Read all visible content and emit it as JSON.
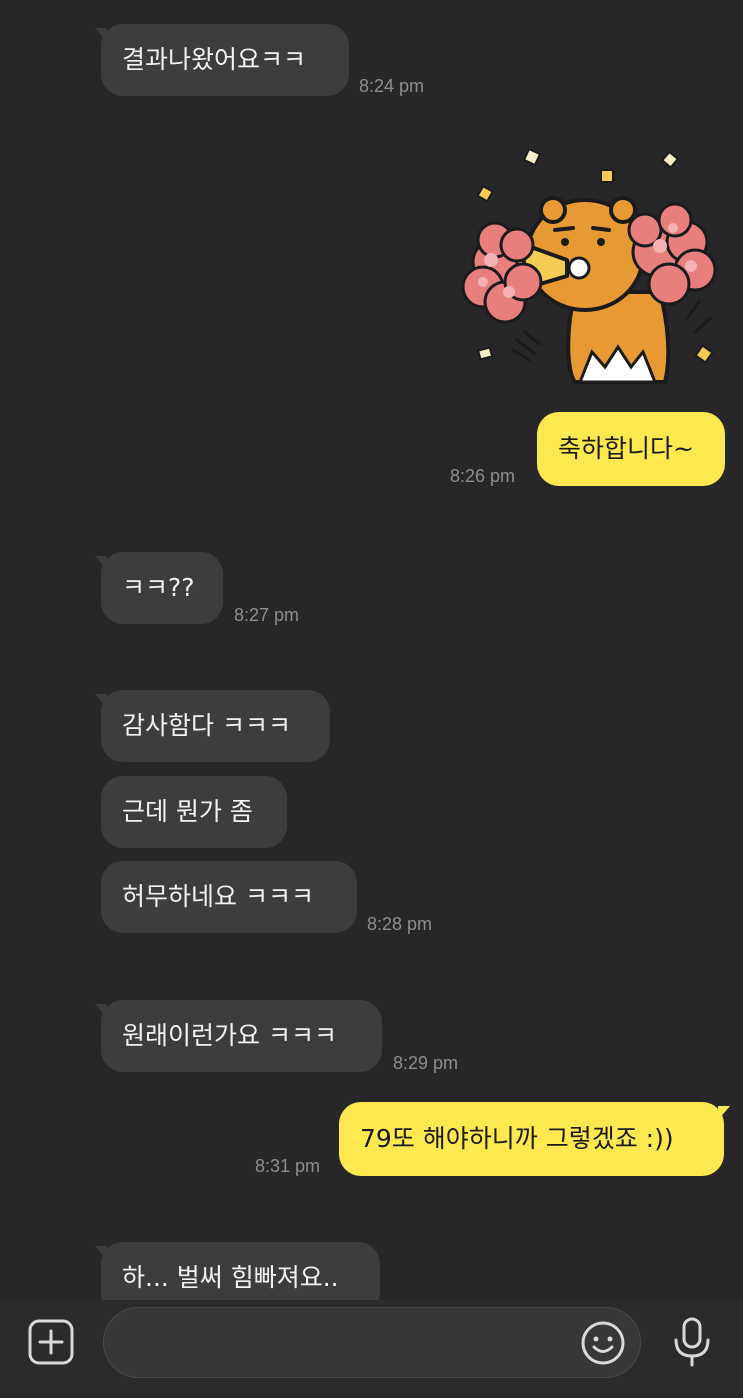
{
  "conversation": {
    "messages": [
      {
        "direction": "incoming",
        "text": "결과나왔어요ㅋㅋ",
        "time": "8:24 pm"
      },
      {
        "direction": "outgoing",
        "type": "sticker",
        "sticker": "ryan-cheering-sticker"
      },
      {
        "direction": "outgoing",
        "text": "축하합니다~",
        "time": "8:26 pm"
      },
      {
        "direction": "incoming",
        "text": "ㅋㅋ??",
        "time": "8:27 pm"
      },
      {
        "direction": "incoming",
        "text": "감사함다 ㅋㅋㅋ"
      },
      {
        "direction": "incoming",
        "text": "근데 뭔가 좀"
      },
      {
        "direction": "incoming",
        "text": "허무하네요 ㅋㅋㅋ",
        "time": "8:28 pm"
      },
      {
        "direction": "incoming",
        "text": "원래이런가요 ㅋㅋㅋ",
        "time": "8:29 pm"
      },
      {
        "direction": "outgoing",
        "text": "79또 해야하니까 그렇겠죠 :))",
        "time": "8:31 pm"
      },
      {
        "direction": "incoming",
        "text": "하... 벌써 힘빠져요.."
      }
    ]
  },
  "composer": {
    "placeholder": "",
    "icons": {
      "add": "plus-square-icon",
      "emoji": "emoji-smile-icon",
      "voice": "microphone-icon"
    }
  },
  "colors": {
    "background": "#272729",
    "incoming_bubble": "#3d3d40",
    "outgoing_bubble": "#fde94f",
    "timestamp": "#8e8e90"
  }
}
